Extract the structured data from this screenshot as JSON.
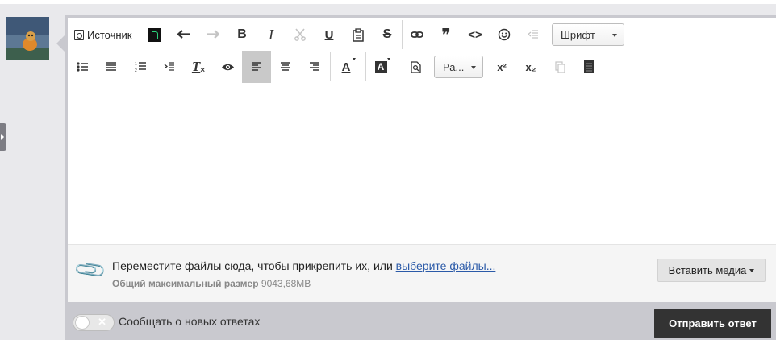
{
  "toolbar": {
    "source_label": "Источник",
    "font_select": "Шрифт",
    "format_select": "Ра...",
    "icons": {
      "source": "source-icon",
      "insert_code": "black-square-icon",
      "undo": "undo-icon",
      "redo": "redo-icon",
      "bold": "bold-icon",
      "italic": "italic-icon",
      "cut": "cut-icon",
      "underline": "underline-icon",
      "paste": "paste-icon",
      "strike": "strikethrough-icon",
      "link": "link-icon",
      "quote": "quote-icon",
      "code": "code-icon",
      "smiley": "smiley-icon",
      "indent_disabled": "indent-icon",
      "bullet_list": "bullet-list-icon",
      "justify": "justify-icon",
      "numbered_list": "numbered-list-icon",
      "outdent": "outdent-icon",
      "clear_format": "clear-format-icon",
      "preview": "eye-icon",
      "align_left": "align-left-icon",
      "align_center": "align-center-icon",
      "align_right": "align-right-icon",
      "text_color": "text-color-icon",
      "bg_color": "background-color-icon",
      "find": "find-icon",
      "superscript": "superscript-icon",
      "subscript": "subscript-icon",
      "copy_disabled": "copy-icon",
      "spoiler": "spoiler-icon"
    },
    "glyphs": {
      "bold": "B",
      "italic": "I",
      "underline": "U",
      "strike": "S",
      "quote": "❞",
      "code": "<>",
      "clear": "T",
      "color": "A",
      "super": "x²",
      "sub": "x₂"
    }
  },
  "attach": {
    "text": "Переместите файлы сюда, чтобы прикрепить их, или ",
    "link": "выберите файлы...",
    "size_label": "Общий максимальный размер",
    "size_value": "9043,68MB",
    "media_button": "Вставить медиа"
  },
  "footer": {
    "notify_label": "Сообщать о новых ответах",
    "toggle_state": "off",
    "send_button": "Отправить ответ"
  },
  "colors": {
    "accent_dark": "#333333",
    "link": "#2b5aa8",
    "active_bg": "#c9c9c9"
  }
}
